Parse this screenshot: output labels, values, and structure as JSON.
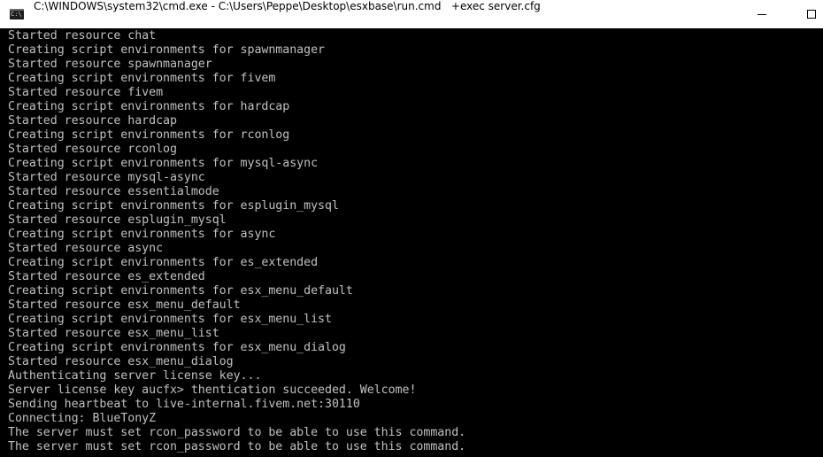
{
  "window": {
    "title": "C:\\WINDOWS\\system32\\cmd.exe - C:\\Users\\Peppe\\Desktop\\esxbase\\run.cmd   +exec server.cfg",
    "icon": "cmd-icon",
    "icon_text": "C:\\"
  },
  "console": {
    "lines": [
      "Started resource chat",
      "Creating script environments for spawnmanager",
      "Started resource spawnmanager",
      "Creating script environments for fivem",
      "Started resource fivem",
      "Creating script environments for hardcap",
      "Started resource hardcap",
      "Creating script environments for rconlog",
      "Started resource rconlog",
      "Creating script environments for mysql-async",
      "Started resource mysql-async",
      "Started resource essentialmode",
      "Creating script environments for esplugin_mysql",
      "Started resource esplugin_mysql",
      "Creating script environments for async",
      "Started resource async",
      "Creating script environments for es_extended",
      "Started resource es_extended",
      "Creating script environments for esx_menu_default",
      "Started resource esx_menu_default",
      "Creating script environments for esx_menu_list",
      "Started resource esx_menu_list",
      "Creating script environments for esx_menu_dialog",
      "Started resource esx_menu_dialog",
      "Authenticating server license key...",
      "Server license key aucfx> thentication succeeded. Welcome!",
      "Sending heartbeat to live-internal.fivem.net:30110",
      "Connecting: BlueTonyZ",
      "The server must set rcon_password to be able to use this command.",
      "The server must set rcon_password to be able to use this command."
    ]
  },
  "colors": {
    "background": "#000000",
    "text": "#c0c0c0",
    "titlebar": "#ffffff"
  }
}
